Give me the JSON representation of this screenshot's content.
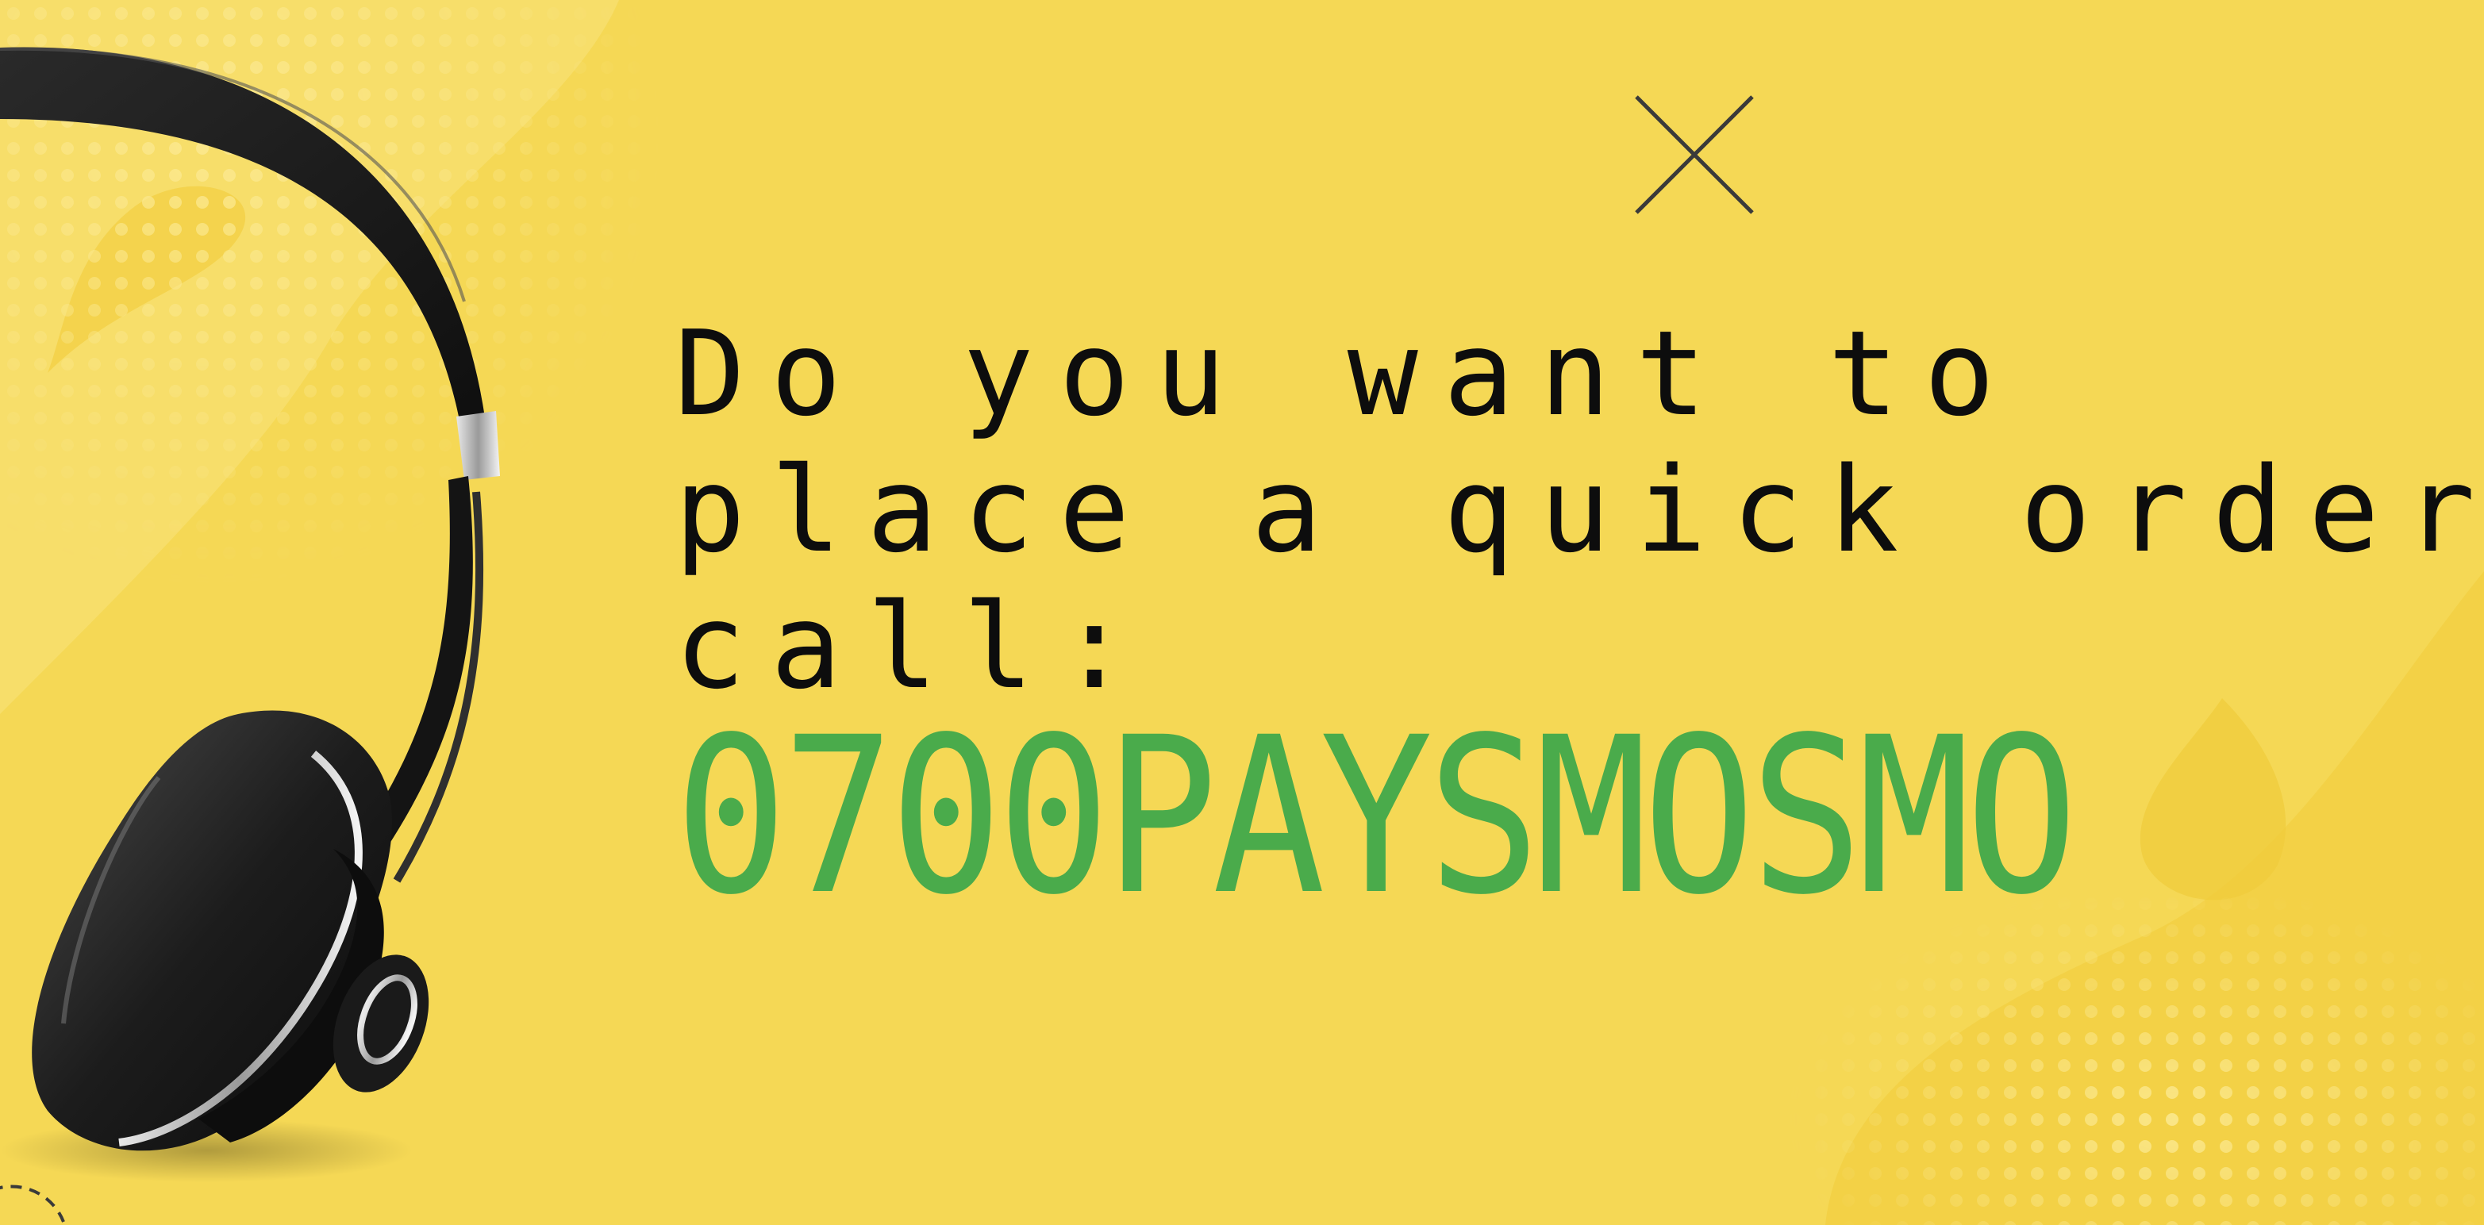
{
  "banner": {
    "background_color": "#f5d855",
    "accent_color": "#4aab4b",
    "text_color": "#0d0d0d",
    "headline": {
      "line1": "Do you want to",
      "line2": "place a quick order?",
      "line3": "call:"
    },
    "phone_number": "0700PAYSMOSMO",
    "icons": {
      "close": "close-icon",
      "headphones": "headphones-icon"
    }
  }
}
